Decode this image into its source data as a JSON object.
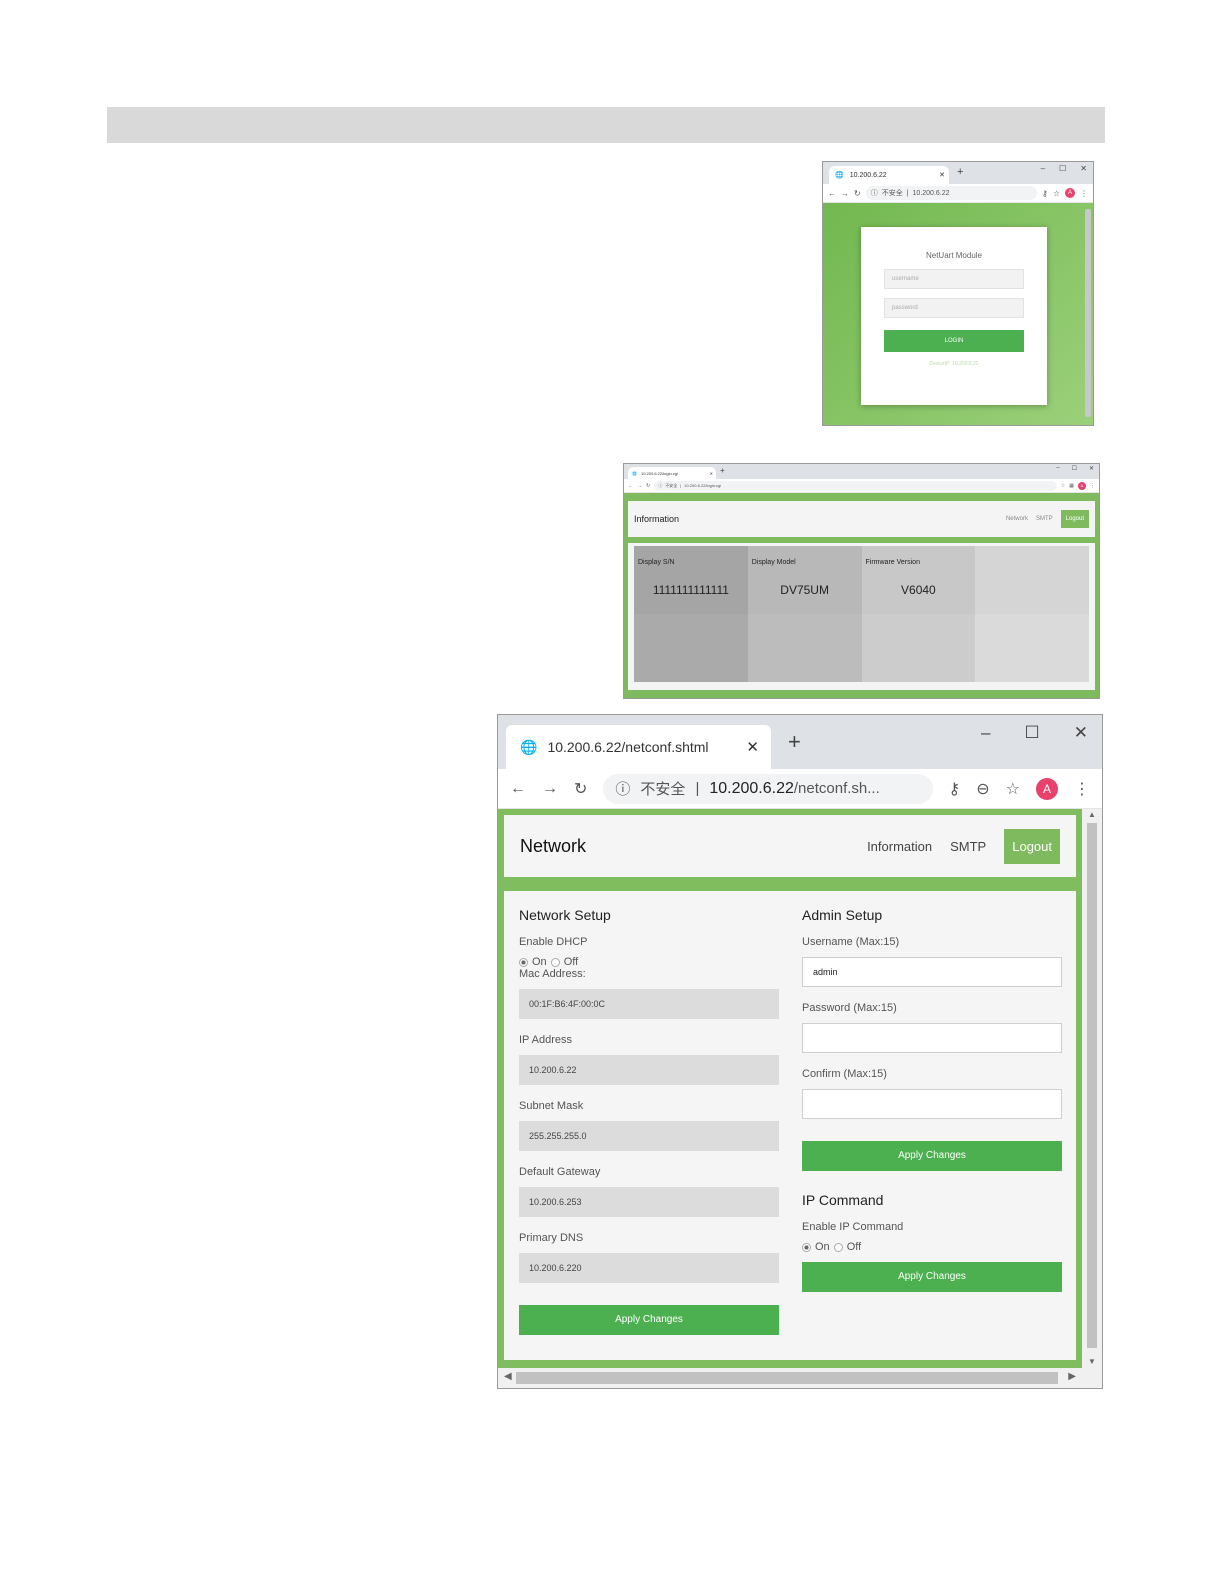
{
  "login_shot": {
    "tab_title": "10.200.6.22",
    "insecure_label": "不安全",
    "url": "10.200.6.22",
    "avatar_letter": "A",
    "card": {
      "title": "NetUart Module",
      "username_placeholder": "username",
      "password_placeholder": "password",
      "login_label": "LOGIN",
      "footer": "DeviceIP: 10.200.6.22"
    }
  },
  "info_shot": {
    "tab_title": "10.200.6.22/login.cgi",
    "insecure_label": "不安全",
    "url": "10.200.6.22/login.cgi",
    "avatar_letter": "A",
    "nav": {
      "title": "Information",
      "network": "Network",
      "smtp": "SMTP",
      "logout": "Logout"
    },
    "cells": [
      {
        "label": "Display S/N",
        "value": "1111111111111",
        "color": "#a5a5a5"
      },
      {
        "label": "Display Model",
        "value": "DV75UM",
        "color": "#b8b8b8"
      },
      {
        "label": "Firmware Version",
        "value": "V6040",
        "color": "#c8c8c8"
      },
      {
        "label": "",
        "value": "",
        "color": "#d5d5d5"
      },
      {
        "label": "",
        "value": "",
        "color": "#aaaaaa"
      },
      {
        "label": "",
        "value": "",
        "color": "#bcbcbc"
      },
      {
        "label": "",
        "value": "",
        "color": "#cccccc"
      },
      {
        "label": "",
        "value": "",
        "color": "#dadada"
      }
    ]
  },
  "network_shot": {
    "tab_title": "10.200.6.22/netconf.shtml",
    "insecure_label": "不安全",
    "url_host": "10.200.6.22",
    "url_path": "/netconf.sh...",
    "avatar_letter": "A",
    "nav": {
      "title": "Network",
      "information": "Information",
      "smtp": "SMTP",
      "logout": "Logout"
    },
    "network_setup": {
      "title": "Network Setup",
      "dhcp_label": "Enable DHCP",
      "on_label": "On",
      "off_label": "Off",
      "dhcp_selected": "On",
      "mac_label": "Mac Address:",
      "mac_value": "00:1F:B6:4F:00:0C",
      "ip_label": "IP Address",
      "ip_value": "10.200.6.22",
      "subnet_label": "Subnet Mask",
      "subnet_value": "255.255.255.0",
      "gateway_label": "Default Gateway",
      "gateway_value": "10.200.6.253",
      "dns_label": "Primary DNS",
      "dns_value": "10.200.6.220",
      "apply_label": "Apply Changes"
    },
    "admin_setup": {
      "title": "Admin Setup",
      "username_label": "Username (Max:15)",
      "username_value": "admin",
      "password_label": "Password (Max:15)",
      "password_value": "",
      "confirm_label": "Confirm (Max:15)",
      "confirm_value": "",
      "apply_label": "Apply Changes"
    },
    "ip_command": {
      "title": "IP Command",
      "enable_label": "Enable IP Command",
      "on_label": "On",
      "off_label": "Off",
      "selected": "On",
      "apply_label": "Apply Changes"
    }
  },
  "colors": {
    "brand_green": "#4caf50",
    "frame_green": "#7fbb5e",
    "avatar_pink": "#e8416b"
  }
}
